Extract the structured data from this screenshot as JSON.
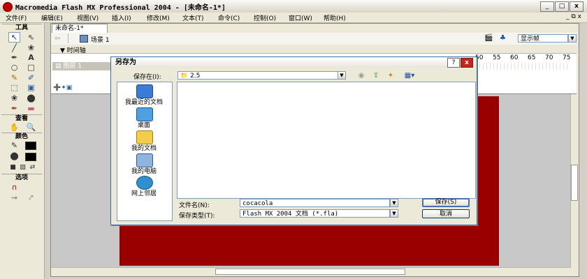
{
  "window": {
    "title": "Macromedia Flash MX Professional 2004 - [未命名-1*]",
    "controls": [
      "_",
      "□",
      "x"
    ]
  },
  "menu": {
    "items": [
      "文件(F)",
      "编辑(E)",
      "视图(V)",
      "插入(I)",
      "修改(M)",
      "文本(T)",
      "命令(C)",
      "控制(O)",
      "窗口(W)",
      "帮助(H)"
    ],
    "mdi_controls": "_ ⧉ x"
  },
  "toolbox": {
    "tools_header": "工具",
    "view_header": "查看",
    "colors_header": "颜色",
    "options_header": "选项"
  },
  "document": {
    "tab_label": "未命名-1*",
    "scene_label": "场景 1",
    "view_dropdown": "显示帧",
    "timeline_label": "时间轴",
    "layer_name": "图层 1",
    "frame_ruler": [
      "50",
      "55",
      "60",
      "65",
      "70",
      "75"
    ],
    "stage_color": "#990000"
  },
  "dialog": {
    "title": "另存为",
    "help_btn": "?",
    "close_btn": "x",
    "save_in_label": "保存在(I):",
    "save_in_value": "2.5",
    "places": [
      "我最近的文档",
      "桌面",
      "我的文档",
      "我的电脑",
      "网上邻居"
    ],
    "filename_label": "文件名(N):",
    "filename_value": "cocacola",
    "filetype_label": "保存类型(T):",
    "filetype_value": "Flash MX 2004 文档 (*.fla)",
    "save_button": "保存(S)",
    "cancel_button": "取消"
  }
}
